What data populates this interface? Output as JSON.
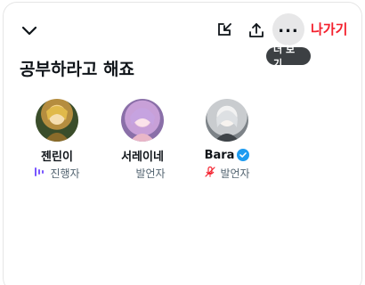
{
  "header": {
    "leave_label": "나가기",
    "more_tooltip": "더 보기"
  },
  "space": {
    "title": "공부하라고 해죠"
  },
  "speakers": [
    {
      "name": "젠린이",
      "role": "진행자",
      "role_icon": "speaking-bars-icon"
    },
    {
      "name": "서레이네",
      "role": "발언자",
      "role_icon": ""
    },
    {
      "name": "Bara",
      "role": "발언자",
      "role_icon": "mic-muted-icon",
      "verified": true
    }
  ],
  "colors": {
    "accent_red": "#f4212e",
    "host_purple": "#7856ff",
    "verified_blue": "#1d9bf0"
  }
}
